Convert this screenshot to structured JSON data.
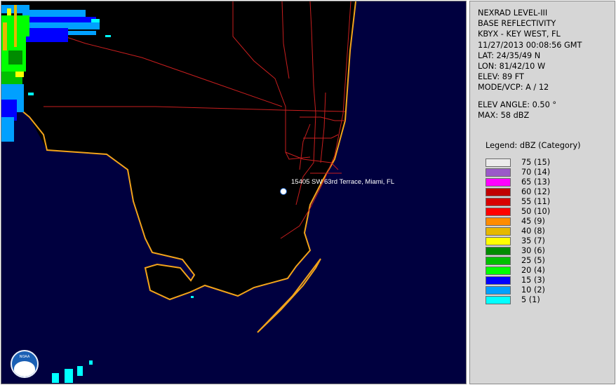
{
  "header": {
    "product": "NEXRAD LEVEL-III",
    "type": "BASE REFLECTIVITY",
    "station": "KBYX - KEY WEST, FL",
    "datetime": "11/27/2013 00:08:56 GMT",
    "lat": "LAT: 24/35/49 N",
    "lon": "LON: 81/42/10 W",
    "elev": "ELEV: 89 FT",
    "mode": "MODE/VCP: A / 12",
    "elev_angle": "ELEV ANGLE: 0.50 °",
    "max": "MAX: 58 dBZ"
  },
  "legend": {
    "title": "Legend: dBZ (Category)",
    "items": [
      {
        "label": "75  (15)",
        "color": "#ececec"
      },
      {
        "label": "70  (14)",
        "color": "#9b59c9"
      },
      {
        "label": "65  (13)",
        "color": "#ff00ff"
      },
      {
        "label": "60  (12)",
        "color": "#c00000"
      },
      {
        "label": "55  (11)",
        "color": "#d80000"
      },
      {
        "label": "50  (10)",
        "color": "#ff0000"
      },
      {
        "label": "45  (9)",
        "color": "#ff8c00"
      },
      {
        "label": "40  (8)",
        "color": "#e6b800"
      },
      {
        "label": "35  (7)",
        "color": "#ffff00"
      },
      {
        "label": "30  (6)",
        "color": "#008c00"
      },
      {
        "label": "25  (5)",
        "color": "#00c000"
      },
      {
        "label": "20  (4)",
        "color": "#00ff00"
      },
      {
        "label": "15  (3)",
        "color": "#0000ff"
      },
      {
        "label": "10  (2)",
        "color": "#00a0ff"
      },
      {
        "label": "5  (1)",
        "color": "#00ffff"
      }
    ]
  },
  "map": {
    "location_label": "15405 SW 63rd Terrace, Miami, FL",
    "logo_text": "NOAA",
    "colors": {
      "sea": "#00003f",
      "land": "#000000",
      "coast": "#f2a31a",
      "roads": "#c81e1e"
    }
  }
}
